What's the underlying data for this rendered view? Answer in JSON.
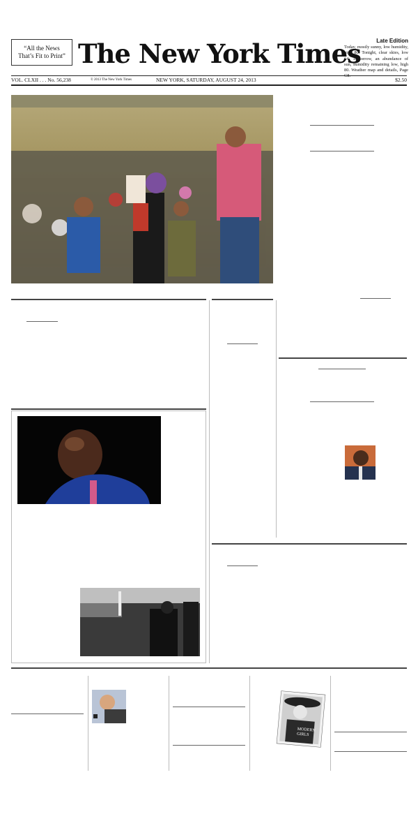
{
  "masthead": {
    "ear_left_line1": "“All the News",
    "ear_left_line2": "That’s Fit to Print”",
    "nameplate": "The New York Times",
    "edition": "Late Edition",
    "weather": "Today, mostly sunny, low humidity, high 80. Tonight, clear skies, low 64. Tomorrow, an abundance of sun, humidity remaining low, high 80. Weather map and details, Page C8."
  },
  "dateline": {
    "volume": "VOL. CLXII . . . No. 56,238",
    "copyright": "© 2013 The New York Times",
    "place_date": "NEW YORK, SATURDAY, AUGUST 24, 2013",
    "price": "$2.50"
  },
  "inset_magazine_cover": {
    "title_line1": "MODERN",
    "title_line2": "GIRLS"
  }
}
